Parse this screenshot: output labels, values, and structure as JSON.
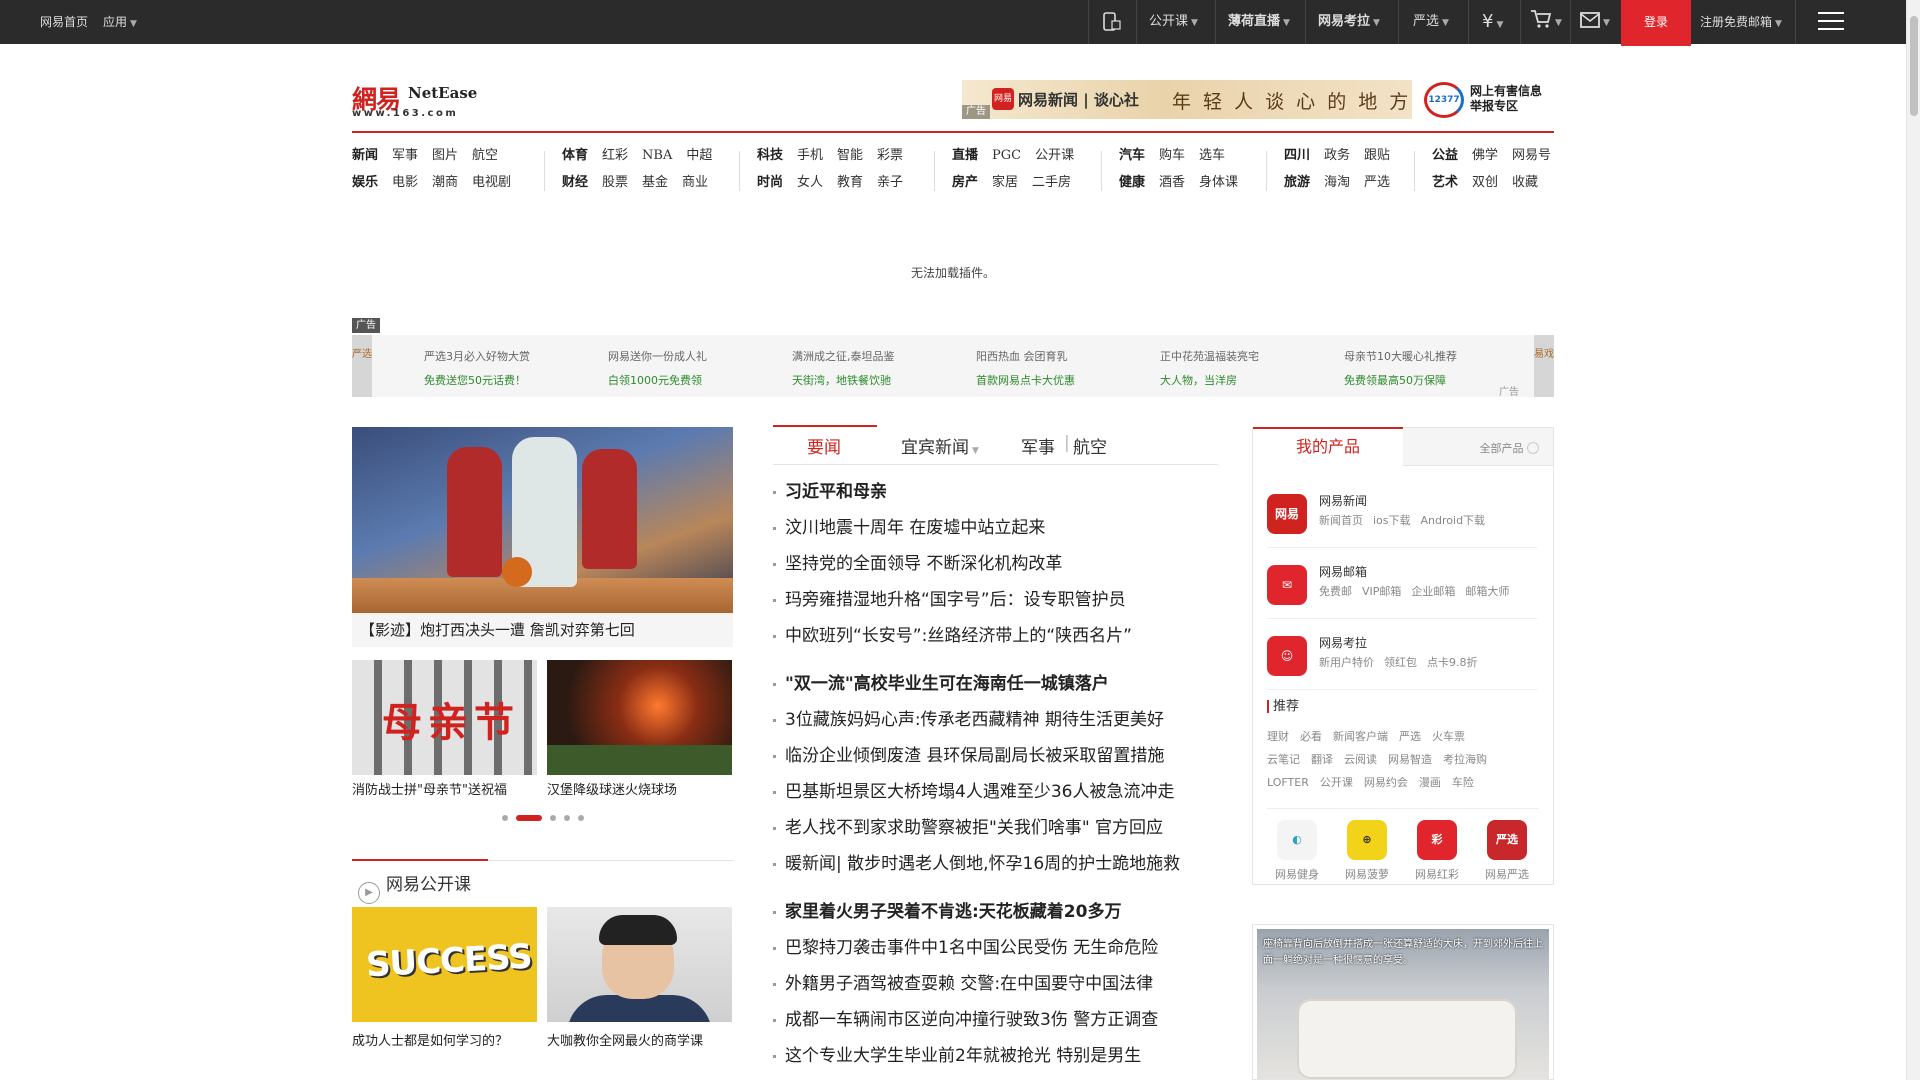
{
  "topbar": {
    "left": [
      "网易首页",
      "应用"
    ],
    "right": [
      "公开课",
      "网易严选",
      "网易考拉",
      "严选",
      "登录",
      "注册免费邮箱"
    ],
    "login": "登录",
    "register": "注册免费邮箱",
    "gonglike": "公开课",
    "huanan": "薄荷直播",
    "kaola": "网易考拉",
    "yanxuan": "严选",
    "yuan": "¥"
  },
  "header": {
    "logo_cn": "網易",
    "logo_en": "NetEase",
    "logo_url": "www.163.com",
    "banner": {
      "tag": "广告",
      "logo": "网易",
      "line1": "网易新闻 | 谈心社",
      "line2": "年 轻 人 谈 心 的 地 方"
    },
    "report": {
      "badge": "12377",
      "line1": "网上有害信息",
      "line2": "举报专区"
    }
  },
  "nav": {
    "groups": [
      {
        "rows": [
          [
            "新闻",
            "军事",
            "图片",
            "航空"
          ],
          [
            "娱乐",
            "电影",
            "潮商",
            "电视剧"
          ]
        ]
      },
      {
        "rows": [
          [
            "体育",
            "红彩",
            "NBA",
            "中超"
          ],
          [
            "财经",
            "股票",
            "基金",
            "商业"
          ]
        ]
      },
      {
        "rows": [
          [
            "科技",
            "手机",
            "智能",
            "彩票"
          ],
          [
            "时尚",
            "女人",
            "教育",
            "亲子"
          ]
        ]
      },
      {
        "rows": [
          [
            "直播",
            "PGC",
            "公开课"
          ],
          [
            "房产",
            "家居",
            "二手房"
          ]
        ]
      },
      {
        "rows": [
          [
            "汽车",
            "购车",
            "选车"
          ],
          [
            "健康",
            "酒香",
            "身体课"
          ]
        ]
      },
      {
        "rows": [
          [
            "四川",
            "政务",
            "跟贴"
          ],
          [
            "旅游",
            "海淘",
            "严选"
          ]
        ]
      },
      {
        "rows": [
          [
            "公益",
            "佛学",
            "网易号"
          ],
          [
            "艺术",
            "双创",
            "收藏"
          ]
        ]
      }
    ]
  },
  "plugin_msg": "无法加载插件。",
  "ad_strip": {
    "tag": "广告",
    "left": "严选",
    "right": "易戏",
    "corner": "广告",
    "items": [
      {
        "a": "严选3月必入好物大赏",
        "b": "免费送您50元话费！"
      },
      {
        "a": "网易送你一份成人礼",
        "b": "白领1000元免费领"
      },
      {
        "a": "满洲成之征,泰坦品鉴",
        "b": "天街湾，地铁餐饮驰"
      },
      {
        "a": "阳西热血 会团育乳",
        "b": "首款网易点卡大优惠"
      },
      {
        "a": "正中花苑温福装亮宅",
        "b": "大人物，当洋房"
      },
      {
        "a": "母亲节10大暖心礼推荐",
        "b": "免费领最高50万保障"
      }
    ]
  },
  "left": {
    "main_caption": "【影迹】炮打西决头一遭 詹凯对弈第七回",
    "thumb1_caption": "消防战士拼\"母亲节\"送祝福",
    "thumb1_text": "母亲节",
    "thumb2_caption": "汉堡降级球迷火烧球场",
    "open_title": "网易公开课",
    "open1_caption": "成功人士都是如何学习的？",
    "open1_text": "SUCCESS",
    "open2_caption": "大咖教你全网最火的商学课"
  },
  "middle": {
    "tabs": [
      "要闻",
      "宜宾新闻",
      "军事",
      "航空"
    ],
    "news": [
      {
        "t": "习近平和母亲",
        "head": true
      },
      {
        "t": "汶川地震十周年 在废墟中站立起来",
        "head": false
      },
      {
        "t": "坚持党的全面领导 不断深化机构改革",
        "head": false
      },
      {
        "t": "玛旁雍措湿地升格“国字号”后：设专职管护员",
        "head": false
      },
      {
        "t": "中欧班列“长安号”:丝路经济带上的“陕西名片”",
        "head": false
      },
      {
        "t": "\"双一流\"高校毕业生可在海南任一城镇落户",
        "head": true
      },
      {
        "t": "3位藏族妈妈心声:传承老西藏精神 期待生活更美好",
        "head": false
      },
      {
        "t": "临汾企业倾倒废渣 县环保局副局长被采取留置措施",
        "head": false
      },
      {
        "t": "巴基斯坦景区大桥垮塌4人遇难至少36人被急流冲走",
        "head": false
      },
      {
        "t": "老人找不到家求助警察被拒\"关我们啥事\" 官方回应",
        "head": false
      },
      {
        "t": "暖新闻| 散步时遇老人倒地,怀孕16周的护士跪地施救",
        "head": false
      },
      {
        "t": "家里着火男子哭着不肯逃:天花板藏着20多万",
        "head": true
      },
      {
        "t": "巴黎持刀袭击事件中1名中国公民受伤 无生命危险",
        "head": false
      },
      {
        "t": "外籍男子酒驾被查耍赖 交警:在中国要守中国法律",
        "head": false
      },
      {
        "t": "成都一车辆闹市区逆向冲撞行驶致3伤 警方正调查",
        "head": false
      },
      {
        "t": "这个专业大学生毕业前2年就被抢光 特别是男生",
        "head": false
      }
    ]
  },
  "right": {
    "mine": "我的产品",
    "all": "全部产品",
    "products": [
      {
        "name": "网易新闻",
        "icon": "网易",
        "color": "#d0231f",
        "links": [
          "新闻首页",
          "ios下载",
          "Android下载"
        ]
      },
      {
        "name": "网易邮箱",
        "icon": "✉",
        "color": "#e0262c",
        "links": [
          "免费邮",
          "VIP邮箱",
          "企业邮箱",
          "邮箱大师"
        ]
      },
      {
        "name": "网易考拉",
        "icon": "☺",
        "color": "#e0262c",
        "links": [
          "新用户特价",
          "领红包",
          "点卡9.8折"
        ]
      }
    ],
    "rec_title": "推荐",
    "rec_rows": [
      [
        "理财",
        "必看",
        "新闻客户端",
        "严选",
        "火车票"
      ],
      [
        "云笔记",
        "翻译",
        "云阅读",
        "网易智造",
        "考拉海购"
      ],
      [
        "LOFTER",
        "公开课",
        "网易约会",
        "漫画",
        "车险"
      ]
    ],
    "apps": [
      {
        "name": "网易健身",
        "icon": "◐",
        "color": "#f4f4f4",
        "fg": "#2aa3c5"
      },
      {
        "name": "网易菠萝",
        "icon": "⊕",
        "color": "#f3d21a",
        "fg": "#333"
      },
      {
        "name": "网易红彩",
        "icon": "彩",
        "color": "#e0262c",
        "fg": "#fff"
      },
      {
        "name": "网易严选",
        "icon": "严选",
        "color": "#c8282b",
        "fg": "#fff"
      }
    ],
    "car_ad_text": "座椅靠背向后放倒并搭成一张还算舒适的大床，开到郊外后往上面一躺绝对是一种很惬意的享受。"
  }
}
